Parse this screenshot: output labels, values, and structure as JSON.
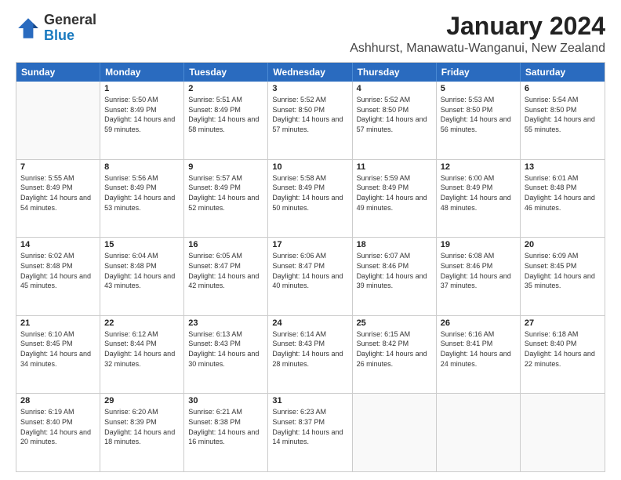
{
  "logo": {
    "general": "General",
    "blue": "Blue"
  },
  "header": {
    "month": "January 2024",
    "location": "Ashhurst, Manawatu-Wanganui, New Zealand"
  },
  "days_of_week": [
    "Sunday",
    "Monday",
    "Tuesday",
    "Wednesday",
    "Thursday",
    "Friday",
    "Saturday"
  ],
  "weeks": [
    [
      {
        "day": "",
        "empty": true
      },
      {
        "day": "1",
        "sunrise": "Sunrise: 5:50 AM",
        "sunset": "Sunset: 8:49 PM",
        "daylight": "Daylight: 14 hours and 59 minutes."
      },
      {
        "day": "2",
        "sunrise": "Sunrise: 5:51 AM",
        "sunset": "Sunset: 8:49 PM",
        "daylight": "Daylight: 14 hours and 58 minutes."
      },
      {
        "day": "3",
        "sunrise": "Sunrise: 5:52 AM",
        "sunset": "Sunset: 8:50 PM",
        "daylight": "Daylight: 14 hours and 57 minutes."
      },
      {
        "day": "4",
        "sunrise": "Sunrise: 5:52 AM",
        "sunset": "Sunset: 8:50 PM",
        "daylight": "Daylight: 14 hours and 57 minutes."
      },
      {
        "day": "5",
        "sunrise": "Sunrise: 5:53 AM",
        "sunset": "Sunset: 8:50 PM",
        "daylight": "Daylight: 14 hours and 56 minutes."
      },
      {
        "day": "6",
        "sunrise": "Sunrise: 5:54 AM",
        "sunset": "Sunset: 8:50 PM",
        "daylight": "Daylight: 14 hours and 55 minutes."
      }
    ],
    [
      {
        "day": "7",
        "sunrise": "Sunrise: 5:55 AM",
        "sunset": "Sunset: 8:49 PM",
        "daylight": "Daylight: 14 hours and 54 minutes."
      },
      {
        "day": "8",
        "sunrise": "Sunrise: 5:56 AM",
        "sunset": "Sunset: 8:49 PM",
        "daylight": "Daylight: 14 hours and 53 minutes."
      },
      {
        "day": "9",
        "sunrise": "Sunrise: 5:57 AM",
        "sunset": "Sunset: 8:49 PM",
        "daylight": "Daylight: 14 hours and 52 minutes."
      },
      {
        "day": "10",
        "sunrise": "Sunrise: 5:58 AM",
        "sunset": "Sunset: 8:49 PM",
        "daylight": "Daylight: 14 hours and 50 minutes."
      },
      {
        "day": "11",
        "sunrise": "Sunrise: 5:59 AM",
        "sunset": "Sunset: 8:49 PM",
        "daylight": "Daylight: 14 hours and 49 minutes."
      },
      {
        "day": "12",
        "sunrise": "Sunrise: 6:00 AM",
        "sunset": "Sunset: 8:49 PM",
        "daylight": "Daylight: 14 hours and 48 minutes."
      },
      {
        "day": "13",
        "sunrise": "Sunrise: 6:01 AM",
        "sunset": "Sunset: 8:48 PM",
        "daylight": "Daylight: 14 hours and 46 minutes."
      }
    ],
    [
      {
        "day": "14",
        "sunrise": "Sunrise: 6:02 AM",
        "sunset": "Sunset: 8:48 PM",
        "daylight": "Daylight: 14 hours and 45 minutes."
      },
      {
        "day": "15",
        "sunrise": "Sunrise: 6:04 AM",
        "sunset": "Sunset: 8:48 PM",
        "daylight": "Daylight: 14 hours and 43 minutes."
      },
      {
        "day": "16",
        "sunrise": "Sunrise: 6:05 AM",
        "sunset": "Sunset: 8:47 PM",
        "daylight": "Daylight: 14 hours and 42 minutes."
      },
      {
        "day": "17",
        "sunrise": "Sunrise: 6:06 AM",
        "sunset": "Sunset: 8:47 PM",
        "daylight": "Daylight: 14 hours and 40 minutes."
      },
      {
        "day": "18",
        "sunrise": "Sunrise: 6:07 AM",
        "sunset": "Sunset: 8:46 PM",
        "daylight": "Daylight: 14 hours and 39 minutes."
      },
      {
        "day": "19",
        "sunrise": "Sunrise: 6:08 AM",
        "sunset": "Sunset: 8:46 PM",
        "daylight": "Daylight: 14 hours and 37 minutes."
      },
      {
        "day": "20",
        "sunrise": "Sunrise: 6:09 AM",
        "sunset": "Sunset: 8:45 PM",
        "daylight": "Daylight: 14 hours and 35 minutes."
      }
    ],
    [
      {
        "day": "21",
        "sunrise": "Sunrise: 6:10 AM",
        "sunset": "Sunset: 8:45 PM",
        "daylight": "Daylight: 14 hours and 34 minutes."
      },
      {
        "day": "22",
        "sunrise": "Sunrise: 6:12 AM",
        "sunset": "Sunset: 8:44 PM",
        "daylight": "Daylight: 14 hours and 32 minutes."
      },
      {
        "day": "23",
        "sunrise": "Sunrise: 6:13 AM",
        "sunset": "Sunset: 8:43 PM",
        "daylight": "Daylight: 14 hours and 30 minutes."
      },
      {
        "day": "24",
        "sunrise": "Sunrise: 6:14 AM",
        "sunset": "Sunset: 8:43 PM",
        "daylight": "Daylight: 14 hours and 28 minutes."
      },
      {
        "day": "25",
        "sunrise": "Sunrise: 6:15 AM",
        "sunset": "Sunset: 8:42 PM",
        "daylight": "Daylight: 14 hours and 26 minutes."
      },
      {
        "day": "26",
        "sunrise": "Sunrise: 6:16 AM",
        "sunset": "Sunset: 8:41 PM",
        "daylight": "Daylight: 14 hours and 24 minutes."
      },
      {
        "day": "27",
        "sunrise": "Sunrise: 6:18 AM",
        "sunset": "Sunset: 8:40 PM",
        "daylight": "Daylight: 14 hours and 22 minutes."
      }
    ],
    [
      {
        "day": "28",
        "sunrise": "Sunrise: 6:19 AM",
        "sunset": "Sunset: 8:40 PM",
        "daylight": "Daylight: 14 hours and 20 minutes."
      },
      {
        "day": "29",
        "sunrise": "Sunrise: 6:20 AM",
        "sunset": "Sunset: 8:39 PM",
        "daylight": "Daylight: 14 hours and 18 minutes."
      },
      {
        "day": "30",
        "sunrise": "Sunrise: 6:21 AM",
        "sunset": "Sunset: 8:38 PM",
        "daylight": "Daylight: 14 hours and 16 minutes."
      },
      {
        "day": "31",
        "sunrise": "Sunrise: 6:23 AM",
        "sunset": "Sunset: 8:37 PM",
        "daylight": "Daylight: 14 hours and 14 minutes."
      },
      {
        "day": "",
        "empty": true
      },
      {
        "day": "",
        "empty": true
      },
      {
        "day": "",
        "empty": true
      }
    ]
  ]
}
